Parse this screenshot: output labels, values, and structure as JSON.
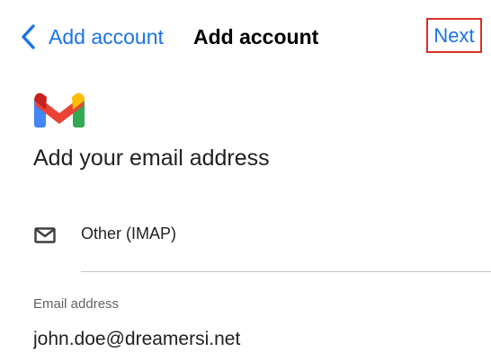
{
  "nav": {
    "back_label": "Add account",
    "title": "Add account",
    "next_label": "Next",
    "back_icon": "chevron-left-icon"
  },
  "main": {
    "logo": "gmail-logo",
    "heading": "Add your email address",
    "account_type": {
      "icon": "mail-icon",
      "label": "Other (IMAP)"
    },
    "email_field": {
      "label": "Email address",
      "value": "john.doe@dreamersi.net"
    }
  },
  "colors": {
    "accent": "#1a73e8",
    "highlight_border": "#d93025",
    "gmail_red": "#ea4335",
    "gmail_blue": "#4285f4",
    "gmail_green": "#34a853",
    "gmail_yellow": "#fbbc04",
    "gmail_dark_red": "#c5221f"
  }
}
